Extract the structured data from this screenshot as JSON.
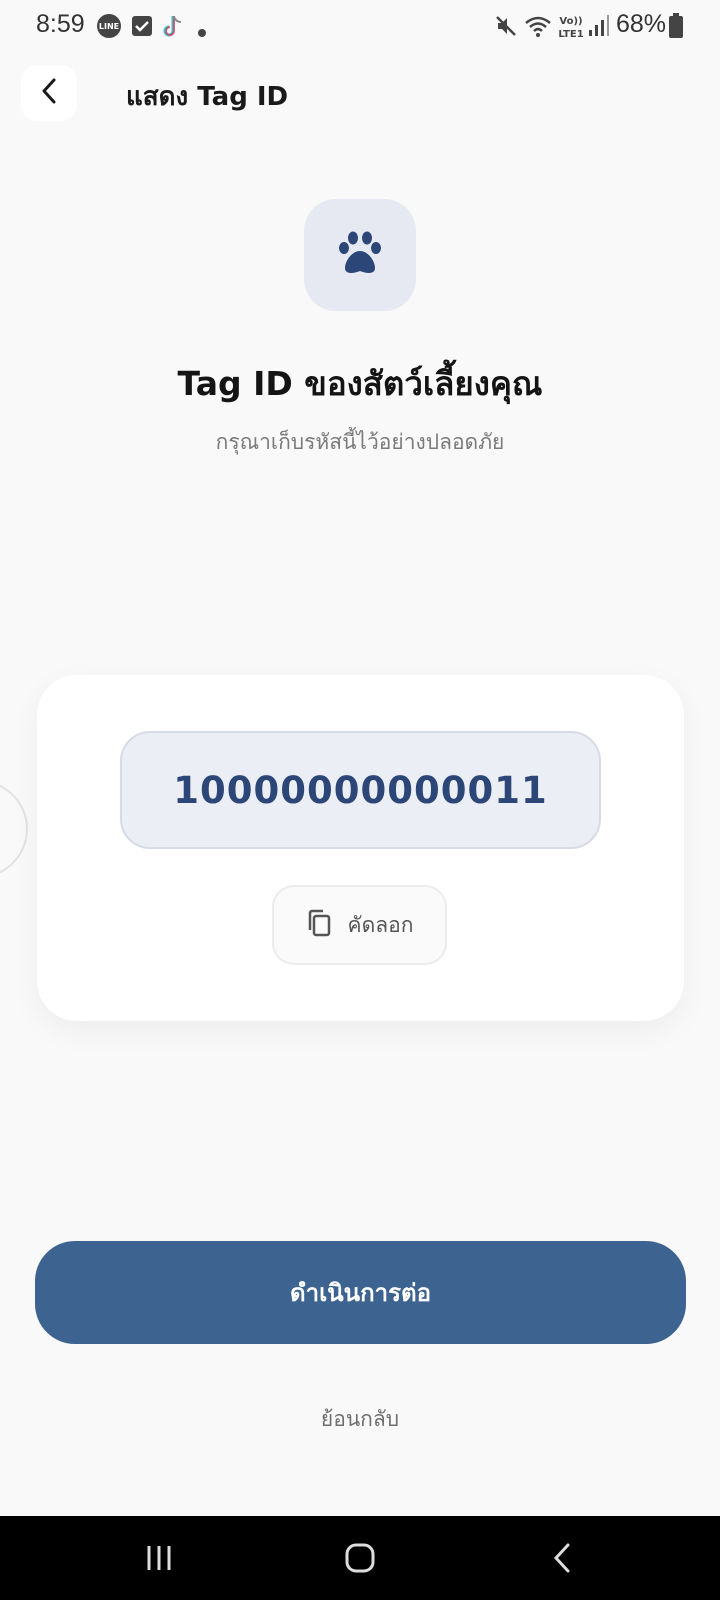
{
  "status_bar": {
    "time": "8:59",
    "battery": "68%",
    "notification_icons": [
      "line-icon",
      "checkbox-icon",
      "tiktok-icon",
      "dot-icon"
    ],
    "system_icons": [
      "mute-icon",
      "wifi-icon",
      "volte-icon",
      "signal-icon",
      "battery-icon"
    ]
  },
  "header": {
    "title": "แสดง Tag ID"
  },
  "hero": {
    "heading": "Tag ID ของสัตว์เลี้ยงคุณ",
    "subheading": "กรุณาเก็บรหัสนี้ไว้อย่างปลอดภัย"
  },
  "tag_card": {
    "tag_id": "10000000000011",
    "copy_label": "คัดลอก"
  },
  "actions": {
    "continue_label": "ดำเนินการต่อ",
    "back_label": "ย้อนกลับ"
  },
  "colors": {
    "primary": "#3d6390",
    "tag_text": "#2b4677",
    "background": "#f9f9f9"
  }
}
